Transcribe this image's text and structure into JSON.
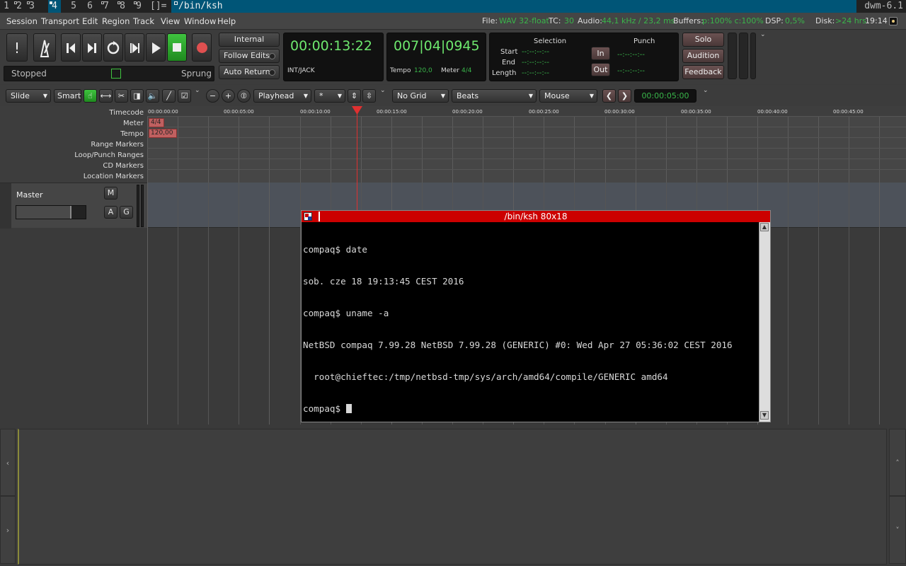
{
  "dwm": {
    "tags": [
      "1",
      "2",
      "3",
      "4",
      "5",
      "6",
      "7",
      "8",
      "9"
    ],
    "selected_tag": "4",
    "layout": "[]=",
    "window_title": "/bin/ksh",
    "status": "dwm-6.1"
  },
  "menubar": {
    "items": [
      "Session",
      "Transport",
      "Edit",
      "Region",
      "Track",
      "View",
      "Window",
      "Help"
    ]
  },
  "statusline": {
    "file_label": "File:",
    "file_value": "WAV 32-float",
    "tc_label": "TC:",
    "tc_value": "30",
    "audio_label": "Audio:",
    "audio_value": "44,1 kHz / 23,2 ms",
    "buffers_label": "Buffers:",
    "buffers_value": "p:100% c:100%",
    "dsp_label": "DSP:",
    "dsp_value": "0,5%",
    "disk_label": "Disk:",
    "disk_value": ">24 hrs",
    "time": "19:14"
  },
  "transport": {
    "status": "Stopped",
    "sprung": "Sprung",
    "internal": "Internal",
    "follow_edits": "Follow Edits",
    "auto_return": "Auto Return",
    "clock_primary": "00:00:13:22",
    "clock_primary_sub": "INT/JACK",
    "clock_secondary": "007|04|0945",
    "tempo_label": "Tempo",
    "tempo_value": "120,0",
    "meter_label": "Meter",
    "meter_value": "4/4",
    "selection_title": "Selection",
    "punch_title": "Punch",
    "start_label": "Start",
    "end_label": "End",
    "length_label": "Length",
    "empty_time": "--:--:--:--",
    "in_label": "In",
    "out_label": "Out",
    "solo": "Solo",
    "audition": "Audition",
    "feedback": "Feedback"
  },
  "edit_toolbar": {
    "edit_mode": "Slide",
    "smart": "Smart",
    "edit_point": "Playhead",
    "nudge": "*",
    "grid": "No Grid",
    "grid_units": "Beats",
    "zoom_focus": "Mouse",
    "nudge_clock": "00:00:05:00"
  },
  "rulers": {
    "labels": [
      "Timecode",
      "Meter",
      "Tempo",
      "Range Markers",
      "Loop/Punch Ranges",
      "CD Markers",
      "Location Markers"
    ],
    "timecodes": [
      "00:00:00:00",
      "00:00:05:00",
      "00:00:10:00",
      "00:00:15:00",
      "00:00:20:00",
      "00:00:25:00",
      "00:00:30:00",
      "00:00:35:00",
      "00:00:40:00",
      "00:00:45:00"
    ],
    "meter_marker": "4/4",
    "tempo_marker": "120,00"
  },
  "master_track": {
    "name": "Master",
    "m": "M",
    "a": "A",
    "g": "G"
  },
  "terminal": {
    "title": "/bin/ksh 80x18",
    "lines": [
      "compaq$ date",
      "sob. cze 18 19:13:45 CEST 2016",
      "compaq$ uname -a",
      "NetBSD compaq 7.99.28 NetBSD 7.99.28 (GENERIC) #0: Wed Apr 27 05:36:02 CEST 2016",
      "  root@chieftec:/tmp/netbsd-tmp/sys/arch/amd64/compile/GENERIC amd64",
      "compaq$ "
    ]
  },
  "colors": {
    "dwm_selected": "#005577",
    "clock_green": "#6ee86e",
    "status_green": "#39b54a",
    "record_red": "#e05050",
    "terminal_title": "#cc0000"
  }
}
